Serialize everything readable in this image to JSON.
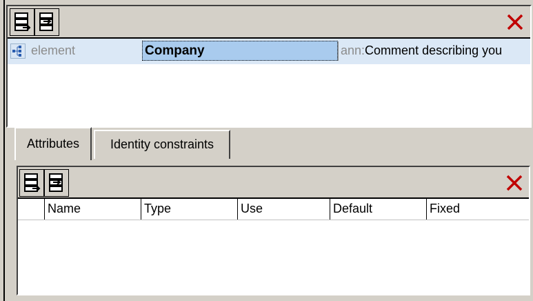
{
  "element_panel": {
    "toolbar": {
      "append_icon": "append-row-icon",
      "insert_icon": "insert-row-icon",
      "delete_icon": "delete-x-icon"
    },
    "row": {
      "icon": "element-node-icon",
      "kind": "element",
      "name": "Company",
      "ann_prefix": "ann:",
      "annotation": "Comment describing you"
    }
  },
  "tabs": [
    {
      "label": "Attributes",
      "active": true
    },
    {
      "label": "Identity constraints",
      "active": false
    }
  ],
  "attributes_panel": {
    "toolbar": {
      "append_icon": "append-row-icon",
      "insert_icon": "insert-row-icon",
      "delete_icon": "delete-x-icon"
    },
    "columns": [
      "Name",
      "Type",
      "Use",
      "Default",
      "Fixed"
    ]
  },
  "colors": {
    "face": "#d4d0c8",
    "row_highlight": "#dbe8f6",
    "selected_cell": "#a9cbee",
    "delete_red": "#c00000"
  }
}
